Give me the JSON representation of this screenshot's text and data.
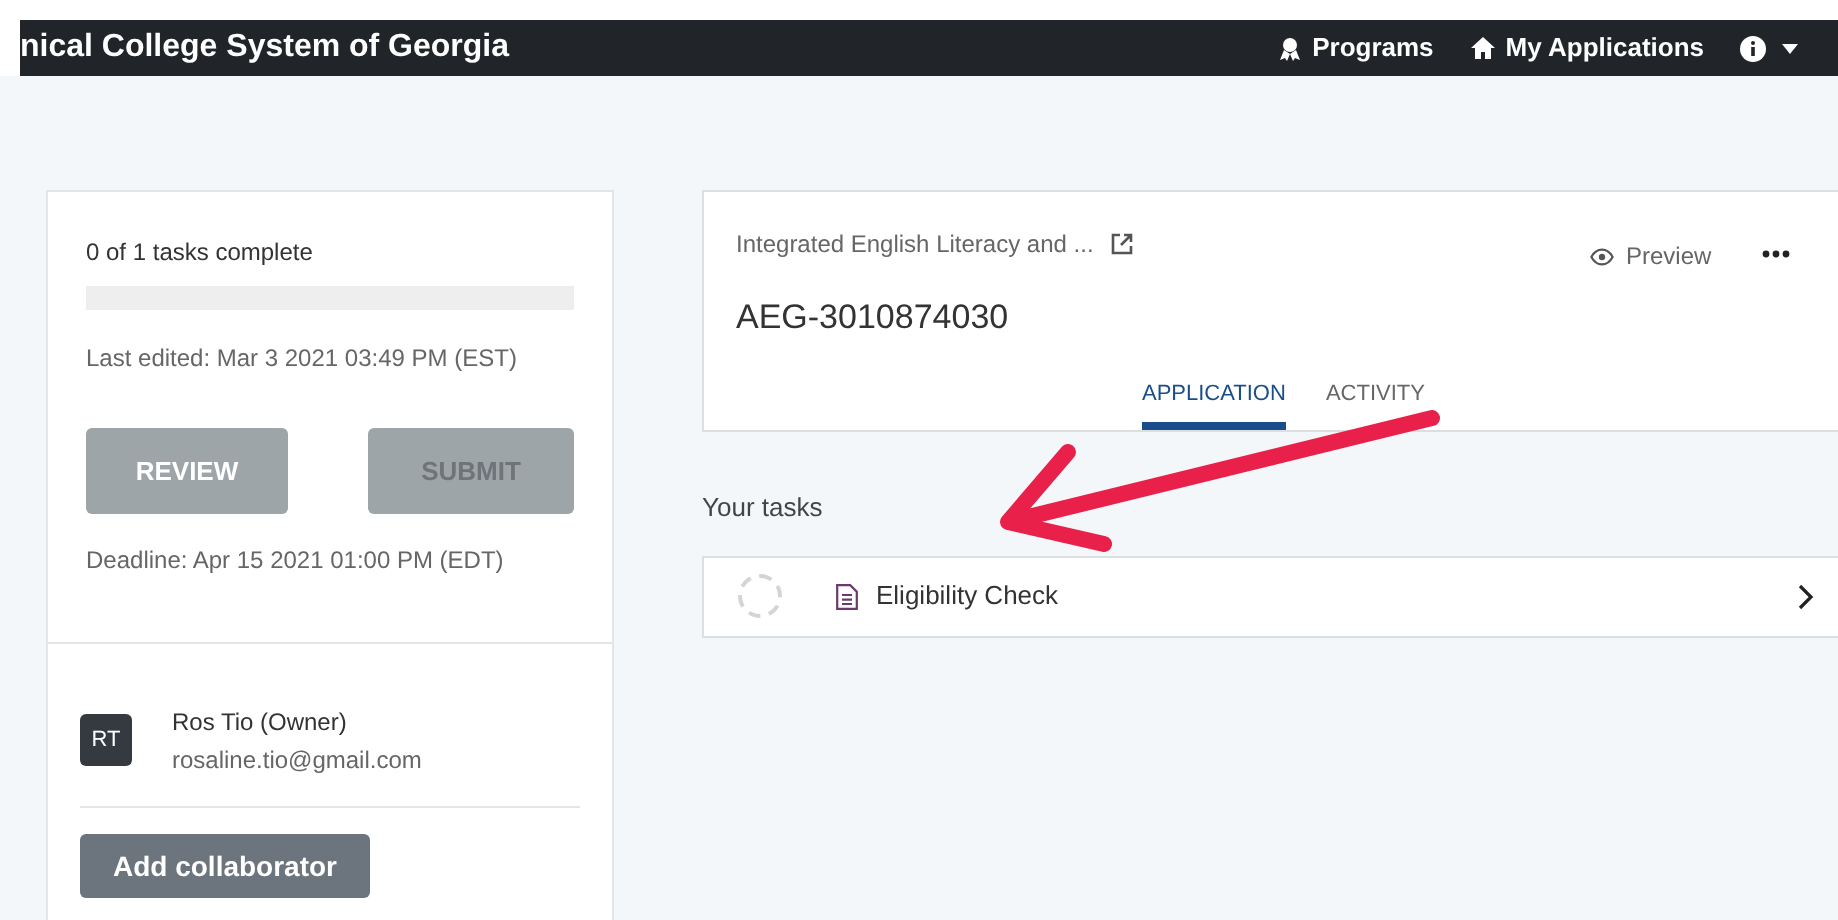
{
  "navbar": {
    "title": "nical College System of Georgia",
    "links": [
      {
        "kind": "programs",
        "label": "Programs"
      },
      {
        "kind": "home",
        "label": "My Applications"
      },
      {
        "kind": "info"
      }
    ]
  },
  "summary": {
    "progress_text": "0 of 1 tasks complete",
    "level": 0,
    "last_edited": "Last edited: Mar 3 2021 03:49 PM (EST)",
    "buttons": [
      {
        "label": "REVIEW",
        "disabled": false
      },
      {
        "label": "SUBMIT",
        "disabled": true
      }
    ],
    "deadline": "Deadline: Apr 15 2021 01:00 PM (EDT)"
  },
  "collaborators": [
    {
      "initials": "RT",
      "name": "Ros Tio (Owner)",
      "email": "rosaline.tio@gmail.com"
    }
  ],
  "add_button": "Add collaborator",
  "application": {
    "program": "Integrated English Literacy and ...",
    "id": "AEG-3010874030",
    "preview": "Preview",
    "tabs": [
      {
        "label": "APPLICATION",
        "selected": true
      },
      {
        "label": "ACTIVITY",
        "selected": false
      }
    ]
  },
  "tasks_heading": "Your tasks",
  "tasks": [
    {
      "label": "Eligibility Check",
      "completed": false
    }
  ]
}
